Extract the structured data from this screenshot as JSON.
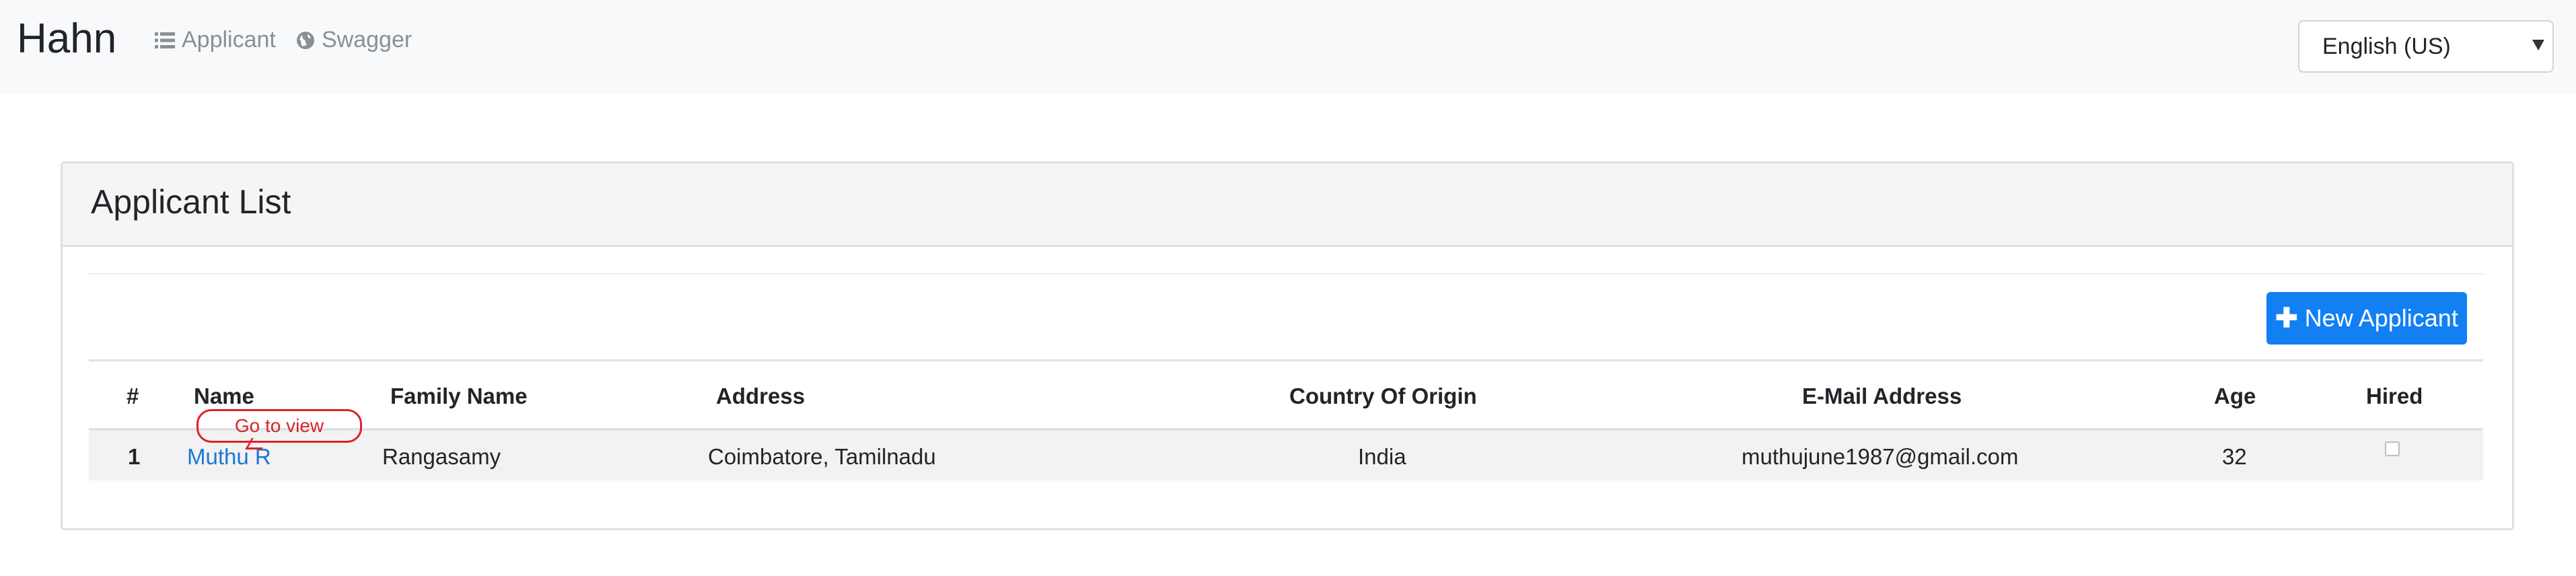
{
  "navbar": {
    "brand": "Hahn",
    "links": [
      {
        "label": "Applicant",
        "icon": "list-icon"
      },
      {
        "label": "Swagger",
        "icon": "globe-icon"
      }
    ],
    "language": {
      "selected": "English (US)"
    }
  },
  "card": {
    "title": "Applicant List",
    "new_button_label": "New Applicant"
  },
  "table": {
    "columns": [
      "#",
      "Name",
      "Family Name",
      "Address",
      "Country Of Origin",
      "E-Mail Address",
      "Age",
      "Hired"
    ],
    "rows": [
      {
        "index": "1",
        "name": "Muthu R",
        "family_name": "Rangasamy",
        "address": "Coimbatore, Tamilnadu",
        "country": "India",
        "email": "muthujune1987@gmail.com",
        "age": "32",
        "hired": false
      }
    ]
  },
  "annotation": {
    "text": "Go to view",
    "color": "#e0202a"
  },
  "colors": {
    "primary": "#1280f3",
    "link": "#1a78d6",
    "navbar_bg": "#f8f9fa"
  }
}
